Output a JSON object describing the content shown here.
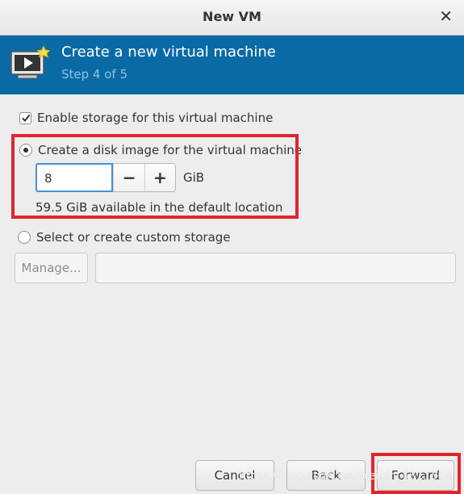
{
  "window": {
    "title": "New VM"
  },
  "header": {
    "title": "Create a new virtual machine",
    "step": "Step 4 of 5"
  },
  "storage": {
    "enable_label": "Enable storage for this virtual machine",
    "enable_checked": true,
    "disk_image_label": "Create a disk image for the virtual machine",
    "disk_size_value": "8",
    "minus_label": "−",
    "plus_label": "+",
    "unit": "GiB",
    "available_text": "59.5 GiB available in the default location",
    "custom_label": "Select or create custom storage",
    "manage_label": "Manage...",
    "custom_path_value": ""
  },
  "footer": {
    "cancel_label": "Cancel",
    "back_label": "Back",
    "forward_label": "Forward"
  },
  "watermark": {
    "text": "https://blog.csdn.net/weixin_43... 304"
  },
  "colors": {
    "header_bg": "#0a6aa5",
    "highlight": "#e1252f",
    "focus": "#4a90d9"
  }
}
